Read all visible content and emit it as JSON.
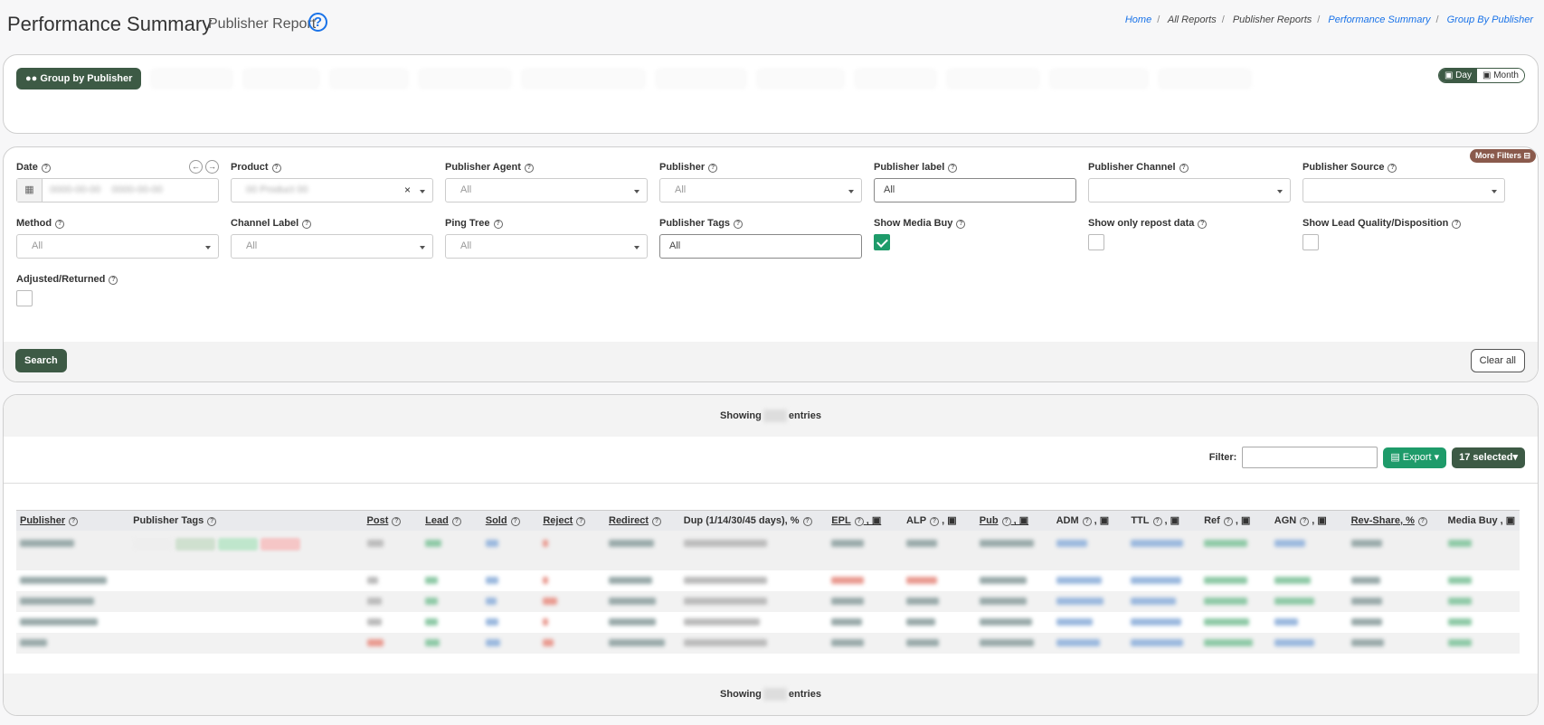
{
  "header": {
    "title": "Performance Summary",
    "subtitle": "Publisher Report",
    "breadcrumb": [
      "Home",
      "All Reports",
      "Publisher Reports",
      "Performance Summary",
      "Group By Publisher"
    ]
  },
  "groups": {
    "active_label": "Group by Publisher",
    "day_label": "Day",
    "month_label": "Month"
  },
  "filters": {
    "more_filters": "More Filters",
    "date_label": "Date",
    "product_label": "Product",
    "publisher_agent_label": "Publisher Agent",
    "publisher_agent_value": "All",
    "publisher_label": "Publisher",
    "publisher_value": "All",
    "publisher_label_label": "Publisher label",
    "publisher_label_value": "All",
    "publisher_channel_label": "Publisher Channel",
    "publisher_source_label": "Publisher Source",
    "method_label": "Method",
    "method_value": "All",
    "channel_label_label": "Channel Label",
    "channel_label_value": "All",
    "ping_tree_label": "Ping Tree",
    "ping_tree_value": "All",
    "publisher_tags_label": "Publisher Tags",
    "publisher_tags_value": "All",
    "show_media_buy_label": "Show Media Buy",
    "show_repost_label": "Show only repost data",
    "show_lead_quality_label": "Show Lead Quality/Disposition",
    "adjusted_label": "Adjusted/Returned",
    "search_button": "Search",
    "clear_button": "Clear all"
  },
  "table": {
    "showing_prefix": "Showing",
    "showing_suffix": "entries",
    "filter_label": "Filter:",
    "export_button": "Export",
    "selected_button": "17 selected",
    "columns": [
      "Publisher",
      "Publisher Tags",
      "Post",
      "Lead",
      "Sold",
      "Reject",
      "Redirect",
      "Dup (1/14/30/45 days), %",
      "EPL",
      "ALP",
      "Pub",
      "ADM",
      "TTL",
      "Ref",
      "AGN",
      "Rev-Share, %",
      "Media Buy"
    ]
  },
  "colors": {
    "brand": "#3d5a45",
    "accent_green": "#1e9b6a",
    "link": "#1a73e8"
  }
}
